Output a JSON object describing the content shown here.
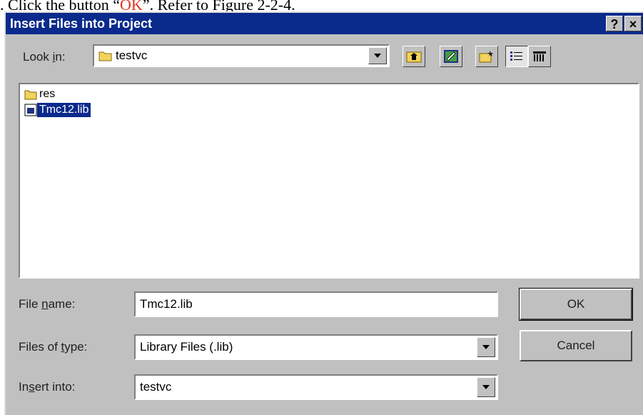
{
  "doc_text": {
    "prefix": ". Click the button “",
    "ok_word": "OK",
    "suffix": "”. Refer to Figure 2-2-4."
  },
  "dialog": {
    "title": "Insert Files into Project",
    "help_glyph": "?",
    "close_glyph": "×"
  },
  "look_in": {
    "label_a": "Look ",
    "label_u": "i",
    "label_b": "n:",
    "value": "testvc"
  },
  "files": [
    {
      "name": "res",
      "icon": "folder-icon",
      "selected": false
    },
    {
      "name": "Tmc12.lib",
      "icon": "library-file-icon",
      "selected": true
    }
  ],
  "file_name": {
    "label_a": "File ",
    "label_u": "n",
    "label_b": "ame:",
    "value": "Tmc12.lib"
  },
  "files_of_type": {
    "label_a": "Files of ",
    "label_u": "t",
    "label_b": "ype:",
    "value": "Library Files (.lib)"
  },
  "insert_into": {
    "label_a": "In",
    "label_u": "s",
    "label_b": "ert into:",
    "value": "testvc"
  },
  "buttons": {
    "ok": "OK",
    "cancel": "Cancel"
  },
  "colors": {
    "titlebar": "#0a2a8c",
    "dialog_bg": "#c0c0c0",
    "selection": "#0a2a8c",
    "ok_word": "#e03020"
  }
}
